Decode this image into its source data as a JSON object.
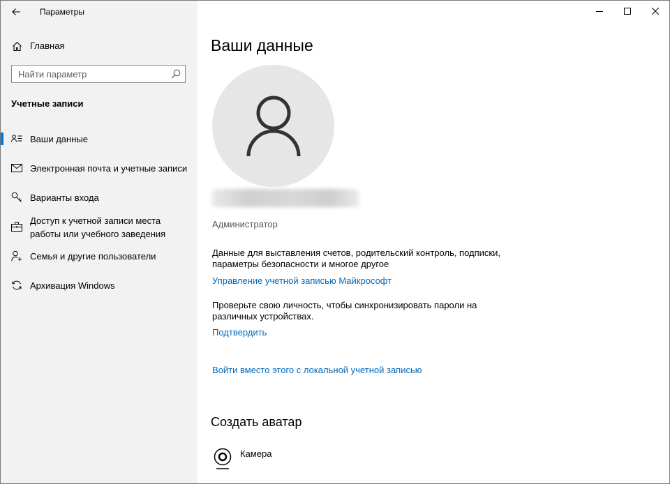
{
  "window": {
    "title": "Параметры"
  },
  "sidebar": {
    "home_label": "Главная",
    "search_placeholder": "Найти параметр",
    "section_title": "Учетные записи",
    "items": [
      {
        "label": "Ваши данные",
        "icon": "user-details-icon",
        "selected": true
      },
      {
        "label": "Электронная почта и учетные записи",
        "icon": "mail-icon"
      },
      {
        "label": "Варианты входа",
        "icon": "key-icon"
      },
      {
        "label": "Доступ к учетной записи места работы или учебного заведения",
        "icon": "briefcase-icon"
      },
      {
        "label": "Семья и другие пользователи",
        "icon": "add-person-icon"
      },
      {
        "label": "Архивация Windows",
        "icon": "sync-icon"
      }
    ],
    "accent_color": "#0078d7"
  },
  "main": {
    "title": "Ваши данные",
    "role": "Администратор",
    "billing_text": "Данные для выставления счетов, родительский контроль, подписки, параметры безопасности и многое другое",
    "manage_link": "Управление учетной записью Майкрософт",
    "verify_text": "Проверьте свою личность, чтобы синхронизировать пароли на различных устройствах.",
    "verify_link": "Подтвердить",
    "local_link": "Войти вместо этого с локальной учетной записью",
    "avatar_section_title": "Создать аватар",
    "camera_label": "Камера",
    "link_color": "#0067b8"
  }
}
